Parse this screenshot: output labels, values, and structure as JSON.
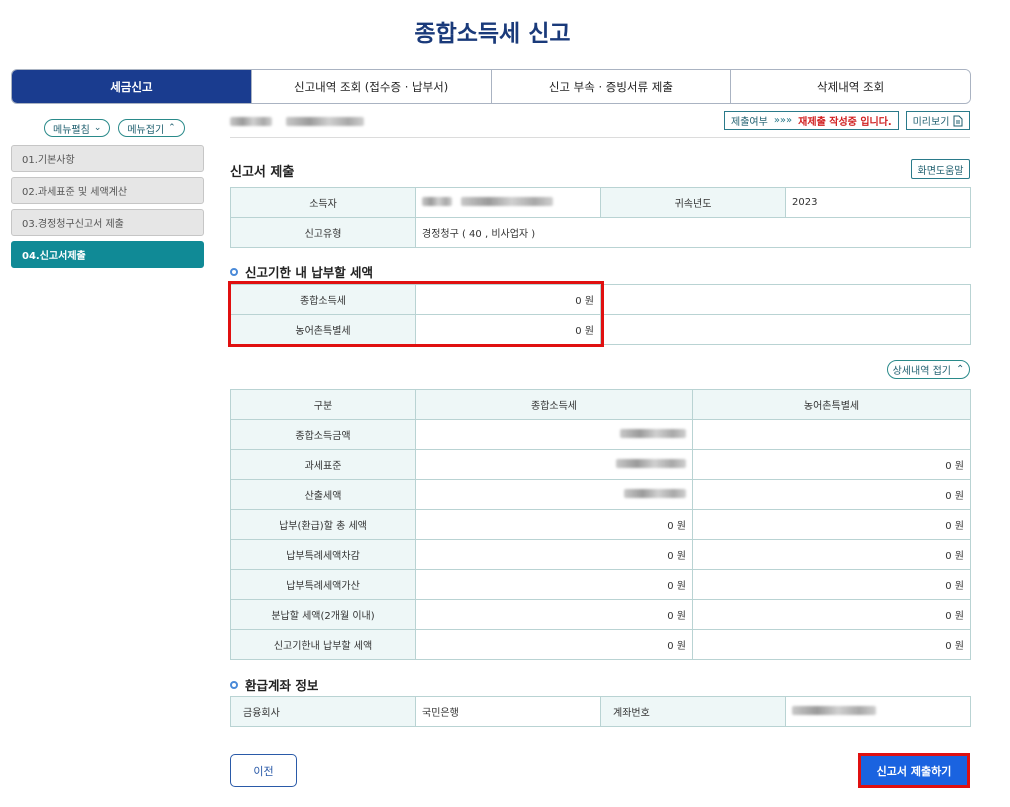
{
  "title": "종합소득세 신고",
  "tabs": [
    {
      "label": "세금신고"
    },
    {
      "label": "신고내역 조회 (접수증 · 납부서)"
    },
    {
      "label": "신고 부속 · 증빙서류 제출"
    },
    {
      "label": "삭제내역 조회"
    }
  ],
  "side": {
    "expand_label": "메뉴펼침",
    "collapse_label": "메뉴접기",
    "items": [
      {
        "label": "01.기본사항"
      },
      {
        "label": "02.과세표준 및 세액계산"
      },
      {
        "label": "03.경정청구신고서 제출"
      },
      {
        "label": "04.신고서제출"
      }
    ]
  },
  "status": {
    "prefix": "제출여부",
    "arrows": "»»»",
    "message": "재제출 작성중 입니다."
  },
  "preview_label": "미리보기",
  "section_title": "신고서 제출",
  "help_label": "화면도움말",
  "info": {
    "taxpayer_label": "소득자",
    "year_label": "귀속년도",
    "year_value": "2023",
    "type_label": "신고유형",
    "type_value": "경정청구 ( 40 , 비사업자 )"
  },
  "due": {
    "title": "신고기한 내 납부할 세액",
    "rows": [
      {
        "label": "종합소득세",
        "value": "0 원"
      },
      {
        "label": "농어촌특별세",
        "value": "0 원"
      }
    ]
  },
  "fold_label": "상세내역 접기",
  "detail": {
    "headers": [
      "구분",
      "종합소득세",
      "농어촌특별세"
    ],
    "rows": [
      {
        "label": "종합소득금액",
        "income": "",
        "rural": ""
      },
      {
        "label": "과세표준",
        "income": "",
        "rural": "0 원"
      },
      {
        "label": "산출세액",
        "income": "",
        "rural": "0 원"
      },
      {
        "label": "납부(환급)할 총 세액",
        "income": "0 원",
        "rural": "0 원"
      },
      {
        "label": "납부특례세액차감",
        "income": "0 원",
        "rural": "0 원"
      },
      {
        "label": "납부특례세액가산",
        "income": "0 원",
        "rural": "0 원"
      },
      {
        "label": "분납할 세액(2개월 이내)",
        "income": "0 원",
        "rural": "0 원"
      },
      {
        "label": "신고기한내 납부할 세액",
        "income": "0 원",
        "rural": "0 원"
      }
    ]
  },
  "refund": {
    "title": "환급계좌 정보",
    "bank_label": "금융회사",
    "bank_value": "국민은행",
    "account_label": "계좌번호"
  },
  "prev_label": "이전",
  "submit_label": "신고서 제출하기"
}
